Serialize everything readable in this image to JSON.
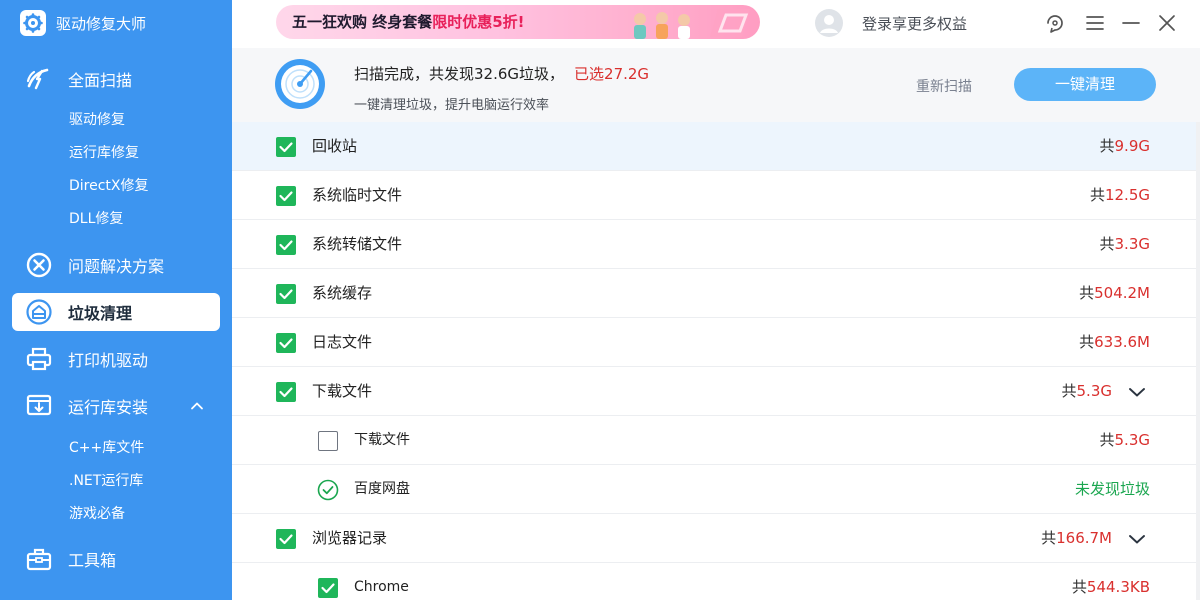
{
  "app": {
    "title": "驱动修复大师"
  },
  "sidebar": {
    "items": [
      {
        "label": "全面扫描",
        "icon": "lightning-wrench-icon"
      },
      {
        "label": "问题解决方案",
        "icon": "close-circle-icon"
      },
      {
        "label": "垃圾清理",
        "icon": "broom-icon",
        "active": true
      },
      {
        "label": "打印机驱动",
        "icon": "printer-icon"
      },
      {
        "label": "运行库安装",
        "icon": "download-box-icon",
        "expanded": true
      },
      {
        "label": "工具箱",
        "icon": "toolbox-icon"
      }
    ],
    "scan_sub": [
      "驱动修复",
      "运行库修复",
      "DirectX修复",
      "DLL修复"
    ],
    "runtime_sub": [
      "C++库文件",
      ".NET运行库",
      "游戏必备"
    ]
  },
  "topbar": {
    "banner_part1": "五一狂欢购 终身套餐",
    "banner_highlight": "限时优惠5折!",
    "login_text": "登录享更多权益"
  },
  "summary": {
    "title": "扫描完成，共发现32.6G垃圾，",
    "selected": "已选27.2G",
    "subtitle": "一键清理垃圾，提升电脑运行效率",
    "rescan_label": "重新扫描",
    "clean_label": "一键清理"
  },
  "rows": [
    {
      "label": "回收站",
      "prefix": "共",
      "value": "9.9G",
      "checked": true
    },
    {
      "label": "系统临时文件",
      "prefix": "共",
      "value": "12.5G",
      "checked": true
    },
    {
      "label": "系统转储文件",
      "prefix": "共",
      "value": "3.3G",
      "checked": true
    },
    {
      "label": "系统缓存",
      "prefix": "共",
      "value": "504.2M",
      "checked": true
    },
    {
      "label": "日志文件",
      "prefix": "共",
      "value": "633.6M",
      "checked": true
    },
    {
      "label": "下载文件",
      "prefix": "共",
      "value": "5.3G",
      "checked": true
    },
    {
      "label": "下载文件",
      "prefix": "共",
      "value": "5.3G",
      "checked": false
    },
    {
      "label": "百度网盘",
      "status": "未发现垃圾"
    },
    {
      "label": "浏览器记录",
      "prefix": "共",
      "value": "166.7M",
      "checked": true
    },
    {
      "label": "Chrome",
      "prefix": "共",
      "value": "544.3KB",
      "checked": true
    }
  ],
  "colors": {
    "sidebar": "#3d95f0",
    "accent_button": "#5cb4f8",
    "checkbox": "#1fb65a",
    "size_red": "#d9302e",
    "ok_green": "#1aa64f"
  }
}
